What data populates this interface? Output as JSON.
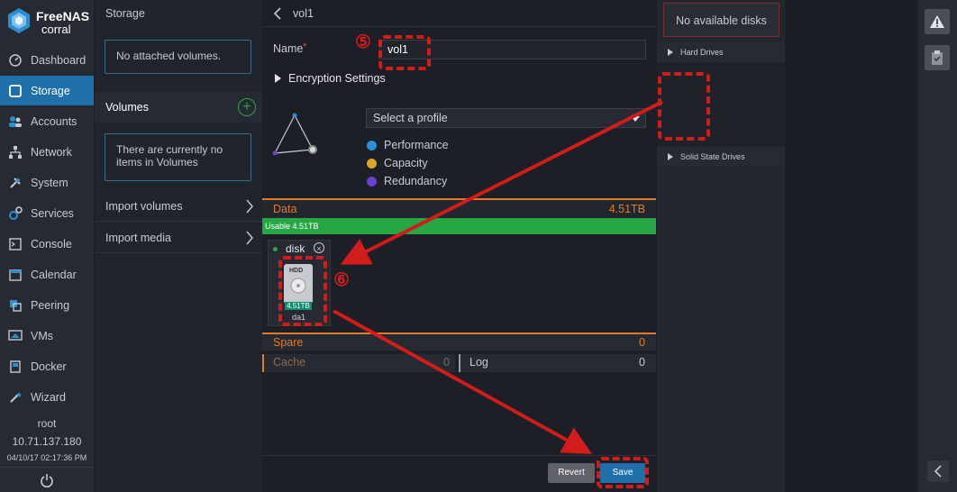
{
  "app": {
    "logo_line1": "FreeNAS",
    "logo_line2": "corral"
  },
  "nav": {
    "items": [
      {
        "label": "Dashboard",
        "icon": "dashboard-icon"
      },
      {
        "label": "Storage",
        "icon": "storage-icon"
      },
      {
        "label": "Accounts",
        "icon": "accounts-icon"
      },
      {
        "label": "Network",
        "icon": "network-icon"
      },
      {
        "label": "System",
        "icon": "system-icon"
      },
      {
        "label": "Services",
        "icon": "services-icon"
      },
      {
        "label": "Console",
        "icon": "console-icon"
      },
      {
        "label": "Calendar",
        "icon": "calendar-icon"
      },
      {
        "label": "Peering",
        "icon": "peering-icon"
      },
      {
        "label": "VMs",
        "icon": "vms-icon"
      },
      {
        "label": "Docker",
        "icon": "docker-icon"
      },
      {
        "label": "Wizard",
        "icon": "wizard-icon"
      }
    ],
    "user": "root",
    "ip": "10.71.137.180",
    "datetime": "04/10/17  02:17:36 PM"
  },
  "storage": {
    "title": "Storage",
    "no_attached": "No attached volumes.",
    "volumes_label": "Volumes",
    "no_items": "There are currently no items in Volumes",
    "import_volumes": "Import volumes",
    "import_media": "Import media"
  },
  "form": {
    "breadcrumb": "vol1",
    "name_label": "Name",
    "required_mark": "*",
    "name_value": "vol1",
    "encryption": "Encryption Settings",
    "profile_placeholder": "Select a profile",
    "legend": [
      {
        "label": "Performance",
        "color": "#2d8fd8"
      },
      {
        "label": "Capacity",
        "color": "#e0a423"
      },
      {
        "label": "Redundancy",
        "color": "#6b3fd1"
      }
    ],
    "data_label": "Data",
    "data_size": "4.51TB",
    "usable": "Usable 4.51TB",
    "disk_group": "disk",
    "disk_type": "HDD",
    "disk_size": "4.51TB",
    "disk_name": "da1",
    "spare_label": "Spare",
    "spare_value": "0",
    "cache_label": "Cache",
    "cache_value": "0",
    "log_label": "Log",
    "log_value": "0",
    "revert": "Revert",
    "save": "Save"
  },
  "right": {
    "no_disks": "No available disks",
    "hard_drives": "Hard Drives",
    "ssd": "Solid State Drives"
  },
  "annotations": {
    "step5": "⑤",
    "step6": "⑥"
  }
}
